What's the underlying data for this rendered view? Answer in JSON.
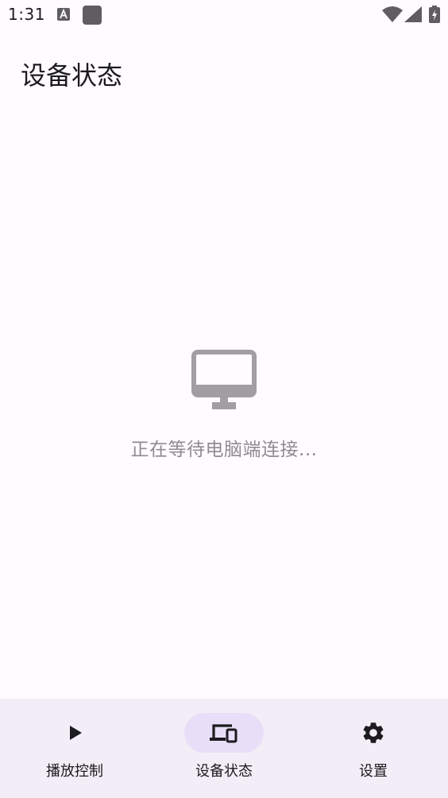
{
  "status_bar": {
    "time": "1:31",
    "icons": [
      "notification-a-icon",
      "notification-square-icon",
      "wifi-icon",
      "signal-icon",
      "battery-charging-icon"
    ]
  },
  "page": {
    "title": "设备状态"
  },
  "empty_state": {
    "icon": "monitor-icon",
    "message": "正在等待电脑端连接..."
  },
  "bottom_nav": {
    "active_index": 1,
    "items": [
      {
        "label": "播放控制",
        "icon": "play-icon"
      },
      {
        "label": "设备状态",
        "icon": "devices-icon"
      },
      {
        "label": "设置",
        "icon": "settings-gear-icon"
      }
    ]
  },
  "colors": {
    "background": "#fffbfe",
    "nav_background": "#f3edf7",
    "active_indicator": "#e8def8",
    "muted_text": "#8e8b91",
    "icon_gray": "#a19ea3",
    "text": "#1c1b1f"
  }
}
